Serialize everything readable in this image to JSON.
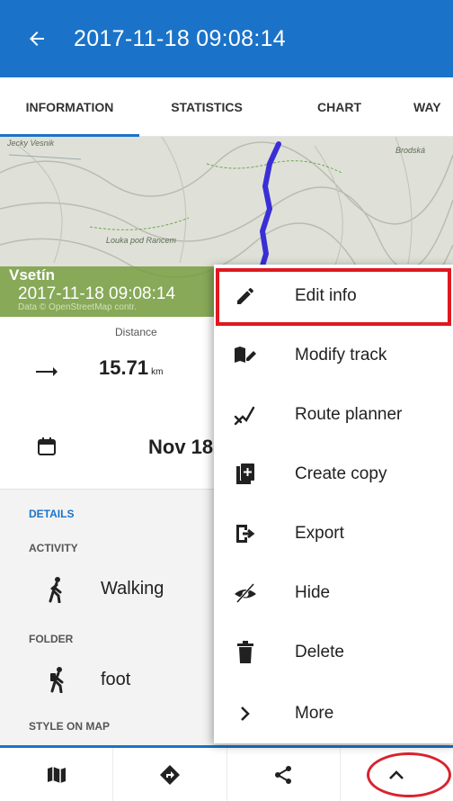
{
  "appbar": {
    "title": "2017-11-18 09:08:14",
    "back_icon": "arrow-back-icon"
  },
  "tabs": [
    {
      "label": "INFORMATION",
      "active": true
    },
    {
      "label": "STATISTICS",
      "active": false
    },
    {
      "label": "CHART",
      "active": false
    },
    {
      "label": "WAY",
      "active": false
    }
  ],
  "map": {
    "labels": [
      "Vsetín",
      "Brodská",
      "Louka pod Rancem",
      "Jecky Vesnik"
    ],
    "city": "Vsetín",
    "time": "2017-11-18 09:08:14",
    "attribution": "Data © OpenStreetMap contr."
  },
  "stats": {
    "distance_label": "Distance",
    "distance_value": "15.71",
    "distance_unit": "km",
    "date_value": "Nov 18"
  },
  "details": {
    "section_title": "DETAILS",
    "activity_label": "ACTIVITY",
    "activity_value": "Walking",
    "folder_label": "FOLDER",
    "folder_value": "foot",
    "style_label": "STYLE ON MAP"
  },
  "menu": {
    "items": [
      {
        "label": "Edit info",
        "icon": "pencil-icon"
      },
      {
        "label": "Modify track",
        "icon": "map-edit-icon"
      },
      {
        "label": "Route planner",
        "icon": "route-planner-icon"
      },
      {
        "label": "Create copy",
        "icon": "copy-icon"
      },
      {
        "label": "Export",
        "icon": "export-icon"
      },
      {
        "label": "Hide",
        "icon": "eye-off-icon"
      },
      {
        "label": "Delete",
        "icon": "trash-icon"
      },
      {
        "label": "More",
        "icon": "chevron-right-icon"
      }
    ]
  },
  "bottombar": {
    "buttons": [
      "map-icon",
      "navigate-icon",
      "share-icon",
      "chevron-up-icon"
    ]
  },
  "colors": {
    "primary": "#1a73c8",
    "highlight": "#e0181f",
    "track": "#3a2fd6"
  }
}
